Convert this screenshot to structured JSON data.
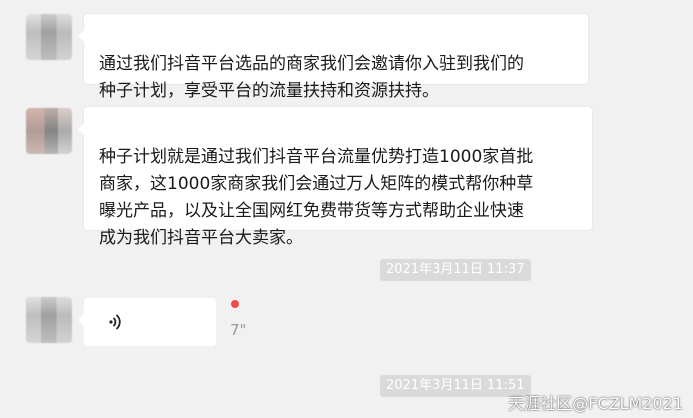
{
  "conversation": {
    "messages": [
      {
        "type": "text",
        "text": "通过我们抖音平台选品的商家我们会邀请你入驻到我们的\n种子计划，享受平台的流量扶持和资源扶持。"
      },
      {
        "type": "text",
        "text": "种子计划就是通过我们抖音平台流量优势打造1000家首批\n商家，这1000家商家我们会通过万人矩阵的模式帮你种草\n曝光产品，以及让全国网红免费带货等方式帮助企业快速\n成为我们抖音平台大卖家。"
      },
      {
        "type": "timestamp",
        "text": "2021年3月11日 11:37"
      },
      {
        "type": "voice",
        "duration": "7\"",
        "unread": true
      },
      {
        "type": "timestamp",
        "text": "2021年3月11日 11:51"
      }
    ]
  },
  "watermark": {
    "text": "天涯社区@FCZLM2021"
  },
  "colors": {
    "background": "#f1f1f1",
    "bubble": "#ffffff",
    "timestamp_bg": "#dadada",
    "unread_dot": "#f04848"
  },
  "icons": {
    "voice": "voice-wave-icon",
    "avatar": "blurred-avatar"
  }
}
